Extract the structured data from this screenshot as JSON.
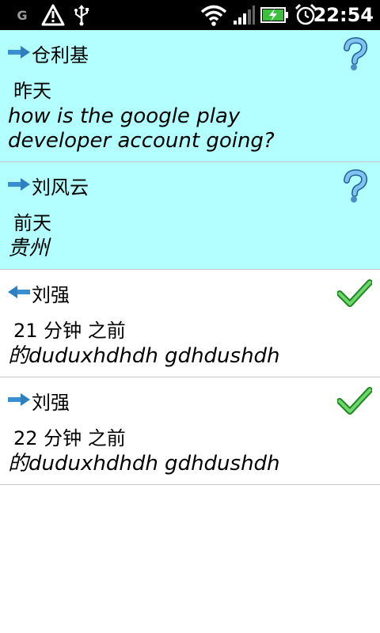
{
  "status_bar": {
    "carrier_letter": "G",
    "time": "22:54",
    "icons": [
      "warning-icon",
      "usb-icon",
      "wifi-icon",
      "signal-icon",
      "battery-charging-icon",
      "alarm-clock-icon"
    ]
  },
  "messages": [
    {
      "direction": "outgoing",
      "name": "仓利基",
      "time": "昨天",
      "text": "how is the google play developer account going?",
      "status": "unknown",
      "read": false
    },
    {
      "direction": "outgoing",
      "name": "刘风云",
      "time": "前天",
      "text": "贵州",
      "status": "unknown",
      "read": false
    },
    {
      "direction": "incoming",
      "name": "刘强",
      "time": "21 分钟 之前",
      "text": "的duduxhdhdh gdhdushdh",
      "status": "delivered",
      "read": true
    },
    {
      "direction": "outgoing",
      "name": "刘强",
      "time": "22 分钟 之前",
      "text": "的duduxhdhdh gdhdushdh",
      "status": "delivered",
      "read": true
    }
  ],
  "colors": {
    "unread_bg": "#b3ffff",
    "read_bg": "#ffffff",
    "status_bar_bg": "#000000",
    "arrow": "#3a8fd0",
    "check": "#2fb02f",
    "question": "#4a90c8"
  }
}
